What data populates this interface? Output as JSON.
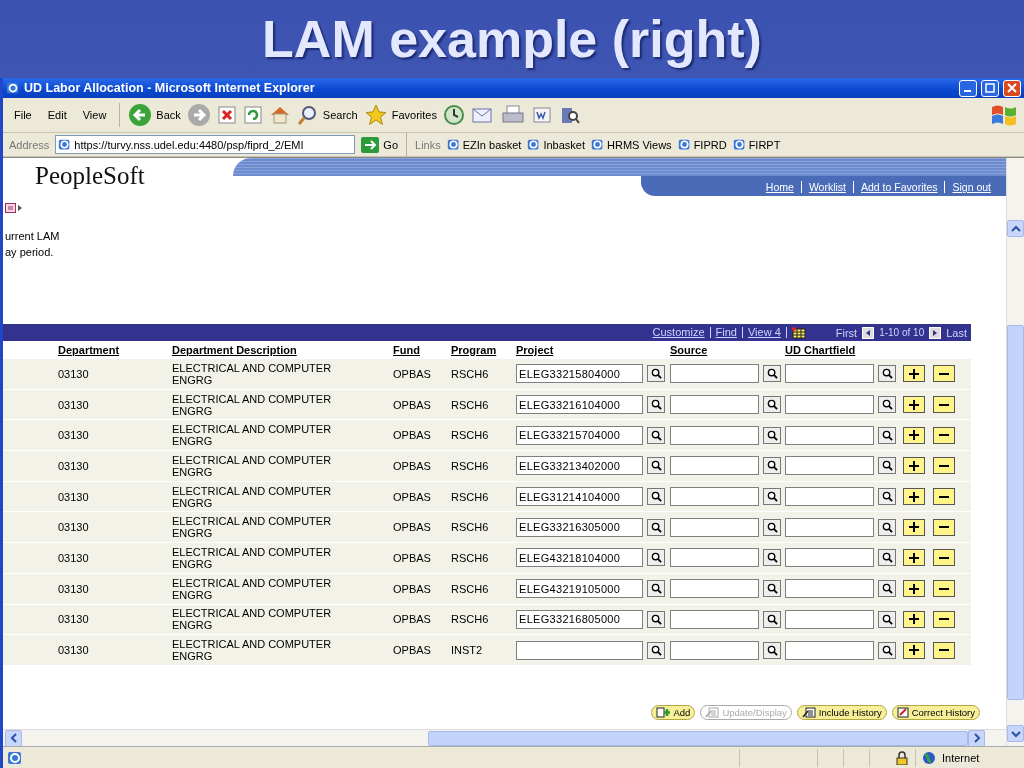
{
  "slide_title": "LAM example (right)",
  "window": {
    "title": "UD Labor Allocation - Microsoft Internet Explorer"
  },
  "menu": [
    "File",
    "Edit",
    "View"
  ],
  "toolbar": [
    {
      "kind": "back",
      "label": "Back"
    },
    {
      "kind": "forward"
    },
    {
      "kind": "stop"
    },
    {
      "kind": "refresh"
    },
    {
      "kind": "home"
    },
    {
      "kind": "search",
      "label": "Search"
    },
    {
      "kind": "favorites",
      "label": "Favorites"
    },
    {
      "kind": "history"
    },
    {
      "kind": "mail"
    },
    {
      "kind": "print"
    },
    {
      "kind": "word"
    },
    {
      "kind": "research"
    }
  ],
  "address": {
    "label": "Address",
    "url": "https://turvy.nss.udel.edu:4480/psp/fiprd_2/EMI",
    "go": "Go"
  },
  "links": {
    "label": "Links",
    "items": [
      "EZIn basket",
      "Inbasket",
      "HRMS Views",
      "FIPRD",
      "FIRPT"
    ]
  },
  "peoplesoft": {
    "logo": "PeopleSoft",
    "nav": [
      "Home",
      "Worklist",
      "Add to Favorites",
      "Sign out"
    ]
  },
  "intro_lines": [
    "urrent LAM",
    "ay period."
  ],
  "grid": {
    "nav": [
      "Customize",
      "Find",
      "View 4"
    ],
    "first": "First",
    "range": "1-10 of 10",
    "last": "Last",
    "columns": [
      "Department",
      "Department Description",
      "Fund",
      "Program",
      "Project",
      "Source",
      "UD Chartfield"
    ],
    "rows": [
      {
        "department": "03130",
        "description": "ELECTRICAL AND COMPUTER ENGRG",
        "fund": "OPBAS",
        "program": "RSCH6",
        "project": "ELEG33215804000"
      },
      {
        "department": "03130",
        "description": "ELECTRICAL AND COMPUTER ENGRG",
        "fund": "OPBAS",
        "program": "RSCH6",
        "project": "ELEG33216104000"
      },
      {
        "department": "03130",
        "description": "ELECTRICAL AND COMPUTER ENGRG",
        "fund": "OPBAS",
        "program": "RSCH6",
        "project": "ELEG33215704000"
      },
      {
        "department": "03130",
        "description": "ELECTRICAL AND COMPUTER ENGRG",
        "fund": "OPBAS",
        "program": "RSCH6",
        "project": "ELEG33213402000"
      },
      {
        "department": "03130",
        "description": "ELECTRICAL AND COMPUTER ENGRG",
        "fund": "OPBAS",
        "program": "RSCH6",
        "project": "ELEG31214104000"
      },
      {
        "department": "03130",
        "description": "ELECTRICAL AND COMPUTER ENGRG",
        "fund": "OPBAS",
        "program": "RSCH6",
        "project": "ELEG33216305000"
      },
      {
        "department": "03130",
        "description": "ELECTRICAL AND COMPUTER ENGRG",
        "fund": "OPBAS",
        "program": "RSCH6",
        "project": "ELEG43218104000"
      },
      {
        "department": "03130",
        "description": "ELECTRICAL AND COMPUTER ENGRG",
        "fund": "OPBAS",
        "program": "RSCH6",
        "project": "ELEG43219105000"
      },
      {
        "department": "03130",
        "description": "ELECTRICAL AND COMPUTER ENGRG",
        "fund": "OPBAS",
        "program": "RSCH6",
        "project": "ELEG33216805000"
      },
      {
        "department": "03130",
        "description": "ELECTRICAL AND COMPUTER ENGRG",
        "fund": "OPBAS",
        "program": "INST2"
      }
    ]
  },
  "bottom_buttons": [
    {
      "kind": "add",
      "label": "Add",
      "disabled": false
    },
    {
      "kind": "update",
      "label": "Update/Display",
      "disabled": true
    },
    {
      "kind": "include",
      "label": "Include History",
      "disabled": false
    },
    {
      "kind": "correct",
      "label": "Correct History",
      "disabled": false
    }
  ],
  "status_bar": {
    "zone": "Internet"
  }
}
